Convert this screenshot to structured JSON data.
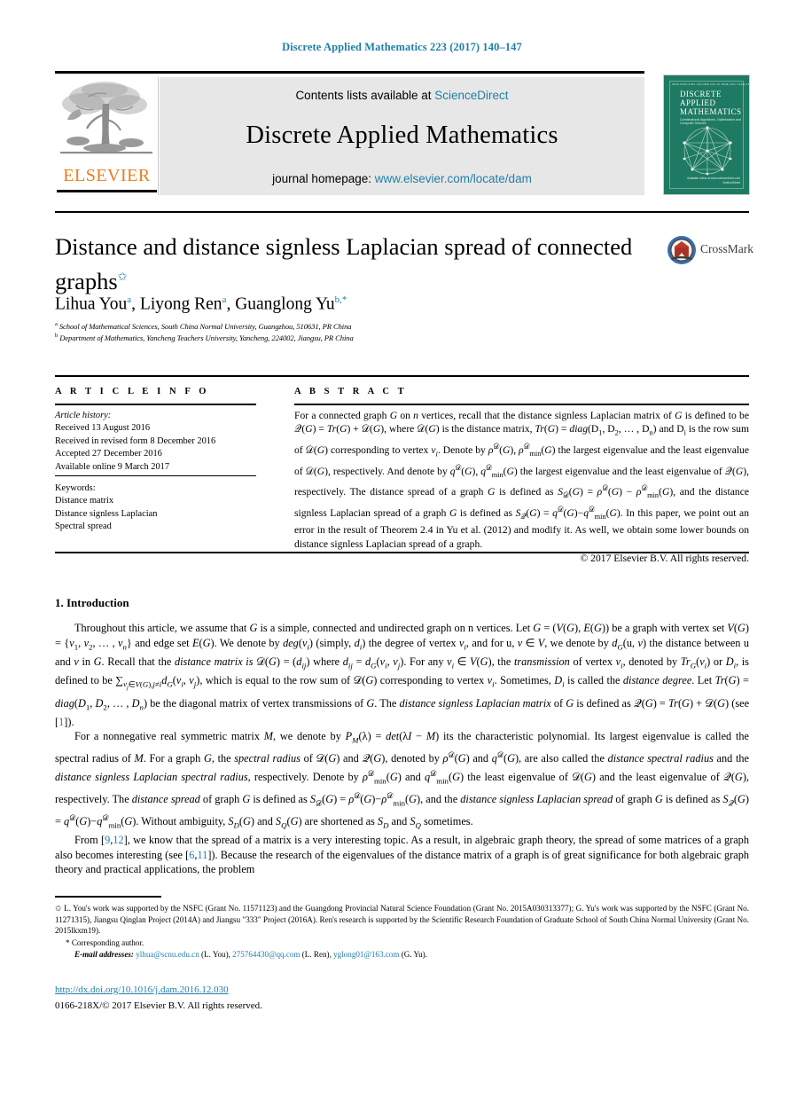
{
  "running_head": "Discrete Applied Mathematics 223 (2017) 140–147",
  "masthead": {
    "contents_prefix": "Contents lists available at ",
    "contents_link": "ScienceDirect",
    "journal_name": "Discrete Applied Mathematics",
    "homepage_prefix": "journal homepage: ",
    "homepage_link": "www.elsevier.com/locate/dam",
    "publisher_logo_text": "ELSEVIER",
    "cover": {
      "top_row": "ISSN 0166-218X      VOLUME 223      15 JUNE 2017      ISSN 0166-218X",
      "title_line1": "DISCRETE",
      "title_line2": "APPLIED",
      "title_line3": "MATHEMATICS",
      "subtitle": "Combinatorial Algorithms, Optimization and Computer Science",
      "footer_line1": "Available online at www.sciencedirect.com",
      "footer_line2": "ScienceDirect"
    }
  },
  "article": {
    "title": "Distance and distance signless Laplacian spread of connected graphs",
    "title_footnote_marker": "✩",
    "authors": [
      {
        "name": "Lihua You",
        "sup": "a"
      },
      {
        "name": "Liyong Ren",
        "sup": "a"
      },
      {
        "name": "Guanglong Yu",
        "sup": "b,*"
      }
    ],
    "authors_plain": "Lihua You a, Liyong Ren a, Guanglong Yu b,*",
    "affiliations": [
      {
        "marker": "a",
        "text": "School of Mathematical Sciences, South China Normal University, Guangzhou, 510631, PR China"
      },
      {
        "marker": "b",
        "text": "Department of Mathematics, Yancheng Teachers University, Yancheng, 224002, Jiangsu, PR China"
      }
    ],
    "crossmark_label": "CrossMark"
  },
  "info": {
    "heading": "A R T I C L E    I N F O",
    "history_label": "Article history:",
    "history": [
      "Received 13 August 2016",
      "Received in revised form 8 December 2016",
      "Accepted 27 December 2016",
      "Available online 9 March 2017"
    ],
    "keywords_label": "Keywords:",
    "keywords": [
      "Distance matrix",
      "Distance signless Laplacian",
      "Spectral spread"
    ]
  },
  "abstract": {
    "heading": "A B S T R A C T",
    "copyright": "© 2017 Elsevier B.V. All rights reserved."
  },
  "body": {
    "section_number": "1.",
    "section_title": "Introduction"
  },
  "footnotes": {
    "funding_marker": "✩",
    "corresponding_marker": "*",
    "corresponding_text": "Corresponding author.",
    "email_label": "E-mail addresses:",
    "emails": [
      {
        "address": "ylhua@scnu.edu.cn",
        "who": "(L. You)"
      },
      {
        "address": "275764430@qq.com",
        "who": "(L. Ren)"
      },
      {
        "address": "yglong01@163.com",
        "who": "(G. Yu)"
      }
    ]
  },
  "footer": {
    "doi": "http://dx.doi.org/10.1016/j.dam.2016.12.030",
    "issn_line": "0166-218X/© 2017 Elsevier B.V. All rights reserved."
  },
  "colors": {
    "link": "#1f7fa8",
    "elsevier_orange": "#E87D1E",
    "cover_green": "#1f7a63",
    "panel_grey": "#e7e7e7"
  }
}
